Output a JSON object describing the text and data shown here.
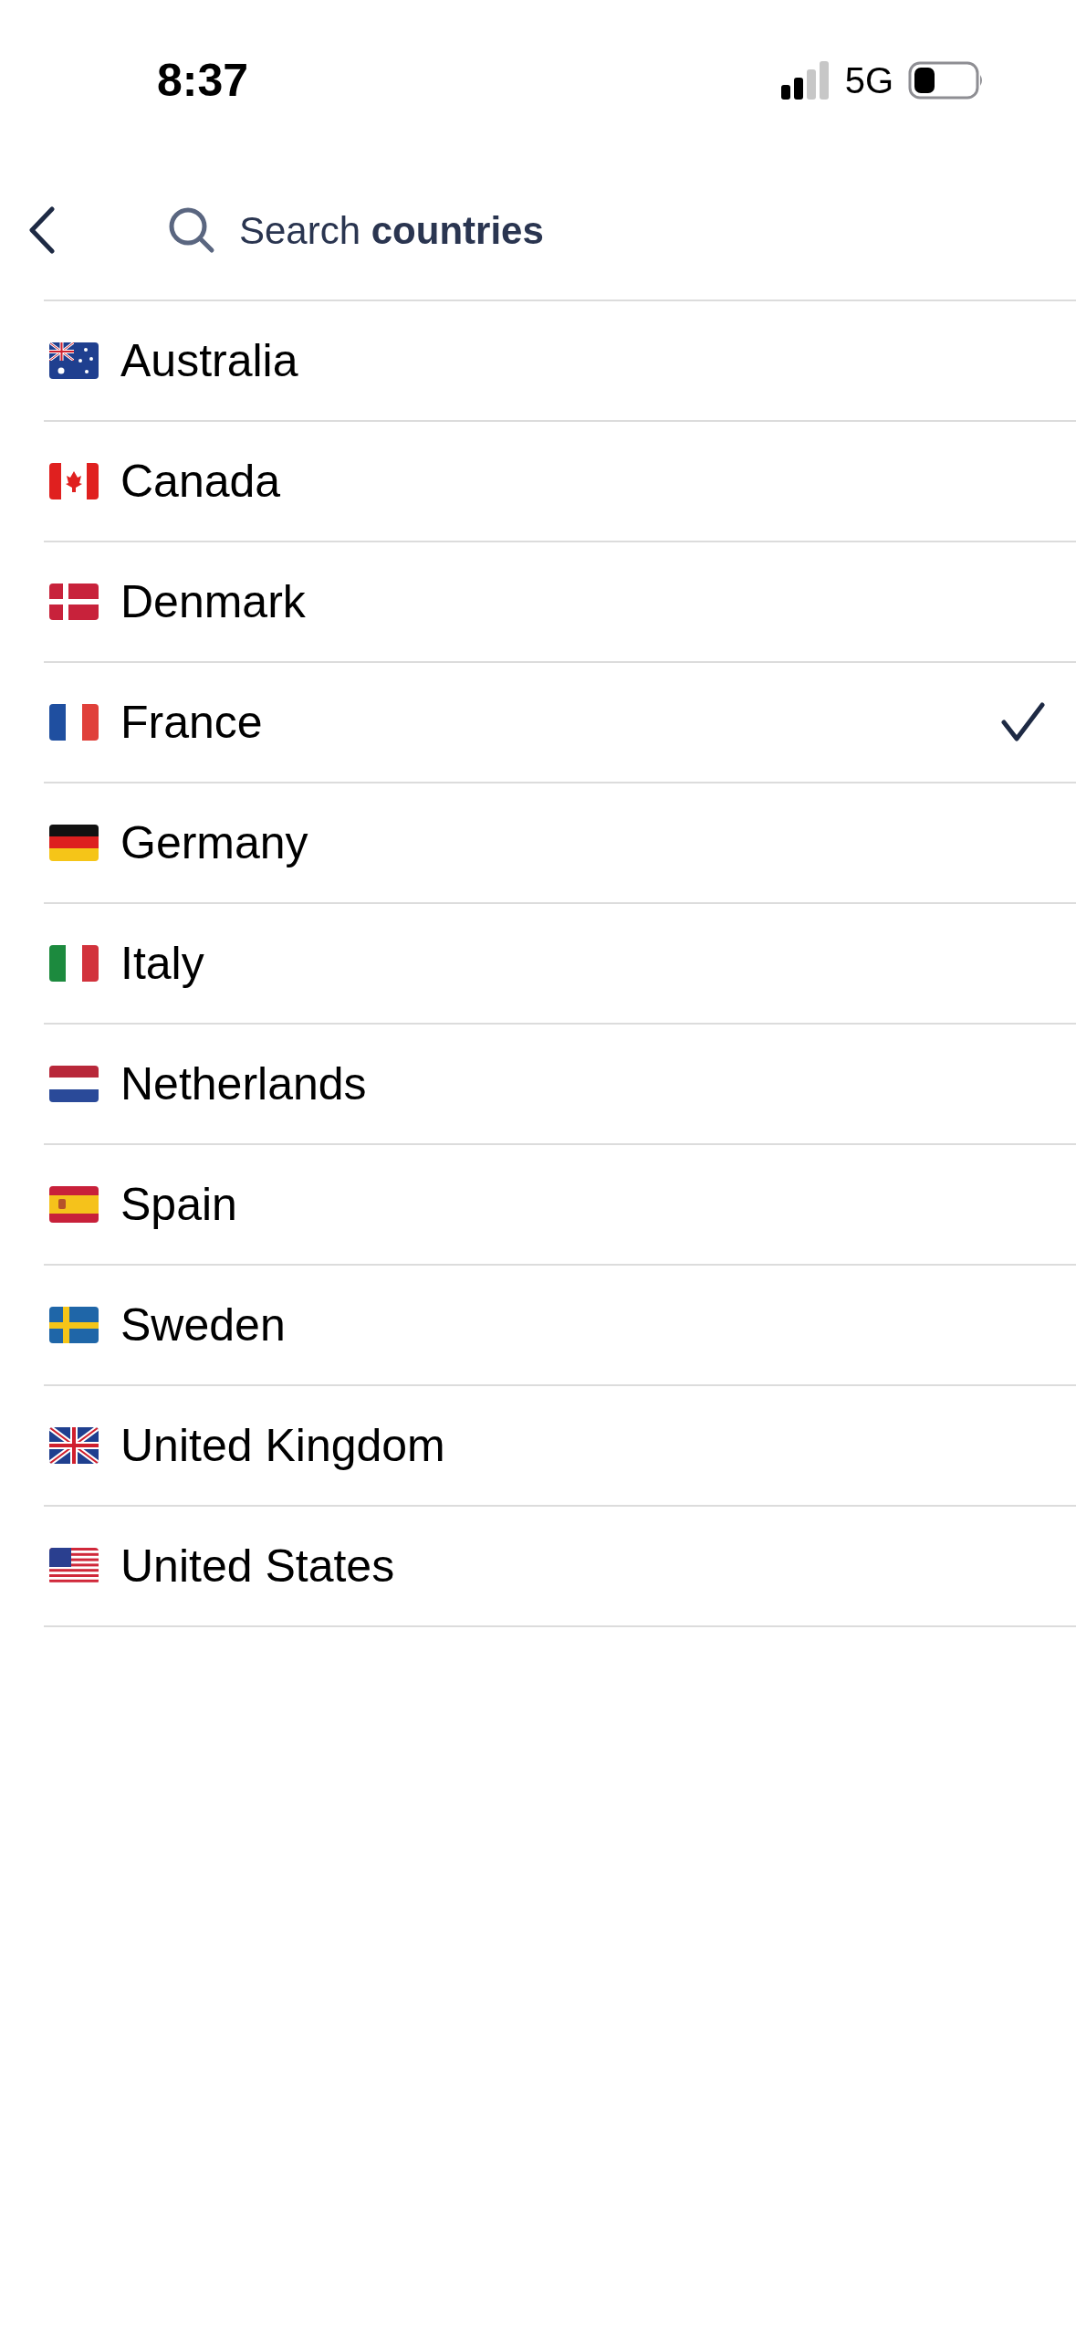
{
  "status_bar": {
    "time": "8:37",
    "network": "5G"
  },
  "search": {
    "placeholder": "Search **countries**"
  },
  "countries": [
    {
      "name": "Australia",
      "selected": false
    },
    {
      "name": "Canada",
      "selected": false
    },
    {
      "name": "Denmark",
      "selected": false
    },
    {
      "name": "France",
      "selected": true
    },
    {
      "name": "Germany",
      "selected": false
    },
    {
      "name": "Italy",
      "selected": false
    },
    {
      "name": "Netherlands",
      "selected": false
    },
    {
      "name": "Spain",
      "selected": false
    },
    {
      "name": "Sweden",
      "selected": false
    },
    {
      "name": "United Kingdom",
      "selected": false
    },
    {
      "name": "United States",
      "selected": false
    }
  ]
}
